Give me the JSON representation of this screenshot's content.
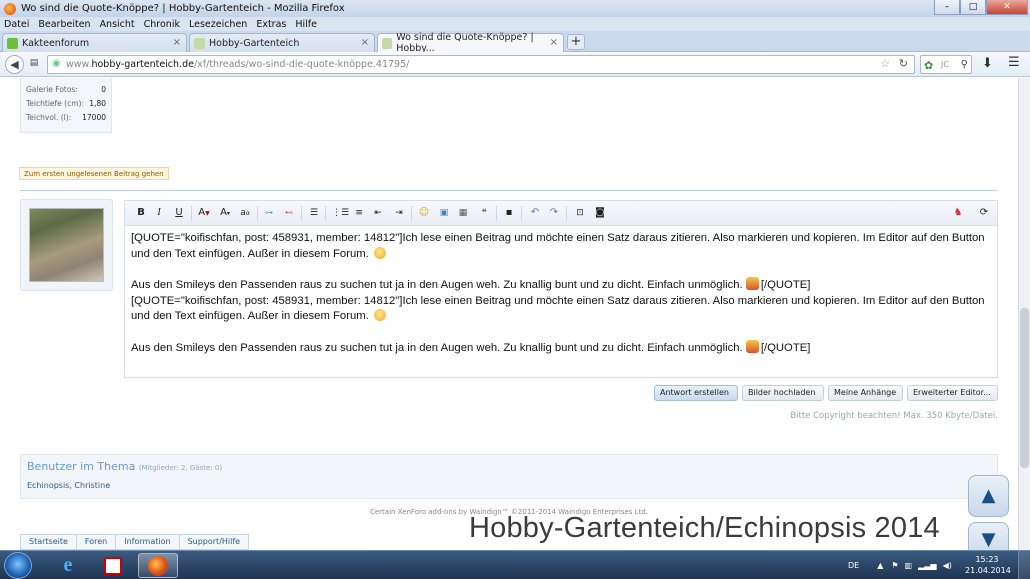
{
  "window": {
    "title": "Wo sind die Quote-Knöppe? | Hobby-Gartenteich - Mozilla Firefox",
    "min": "–",
    "max": "□",
    "close": "✕"
  },
  "menu": [
    "Datei",
    "Bearbeiten",
    "Ansicht",
    "Chronik",
    "Lesezeichen",
    "Extras",
    "Hilfe"
  ],
  "tabs": [
    {
      "label": "Kakteenforum",
      "color": "#6bbf3a"
    },
    {
      "label": "Hobby-Gartenteich",
      "color": "#c7d9a8"
    },
    {
      "label": "Wo sind die Quote-Knöppe? | Hobby...",
      "color": "#c7d9a8"
    }
  ],
  "newtab": "+",
  "nav": {
    "url_prefix": "www.",
    "url_domain": "hobby-gartenteich.de",
    "url_path": "/xf/threads/wo-sind-die-quote-knöppe.41795/",
    "search_placeholder": "JC"
  },
  "stats": [
    {
      "label": "Galerie Fotos:",
      "value": "0"
    },
    {
      "label": "Teichtiefe (cm):",
      "value": "1,80"
    },
    {
      "label": "Teichvol. (l):",
      "value": "17000"
    }
  ],
  "unread_button": "Zum ersten ungelesenen Beitrag gehen",
  "editor": {
    "paragraphs": [
      "[QUOTE=\"koifischfan, post: 458931, member: 14812\"]Ich lese einen Beitrag und möchte einen Satz daraus zitieren. Also markieren und kopieren. Im Editor auf den Button  und den Text einfügen. Außer in diesem Forum.",
      "Aus den Smileys den Passenden raus zu suchen tut ja in den Augen weh. Zu knallig bunt und zu dicht. Einfach unmöglich.",
      "[/QUOTE]",
      "[QUOTE=\"koifischfan, post: 458931, member: 14812\"]Ich lese einen Beitrag und möchte einen Satz daraus zitieren. Also markieren und kopieren. Im Editor auf den Button  und den Text einfügen. Außer in diesem Forum.",
      "Aus den Smileys den Passenden raus zu suchen tut ja in den Augen weh. Zu knallig bunt und zu dicht. Einfach unmöglich.",
      "[/QUOTE]"
    ]
  },
  "buttons": {
    "reply": "Antwort erstellen",
    "upload": "Bilder hochladen",
    "attachments": "Meine Anhänge",
    "advanced": "Erweiterter Editor..."
  },
  "copyright_note": "Bitte Copyright beachten! Max. 350 Kbyte/Datei.",
  "users": {
    "heading": "Benutzer im Thema",
    "sub": "(Mitglieder: 2, Gäste: 0)",
    "names": "Echinopsis, Christine"
  },
  "credits": "Certain XenForo add-ons by Waindigo™ ©2011-2014 Waindigo Enterprises Ltd.",
  "breadcrumb": [
    "Startseite",
    "Foren",
    "Information",
    "Support/Hilfe"
  ],
  "scroll_up": "▲",
  "scroll_down": "▼",
  "watermark": "Hobby-Gartenteich/Echinopsis 2014",
  "taskbar": {
    "lang": "DE",
    "time": "15:23",
    "date": "21.04.2014"
  }
}
